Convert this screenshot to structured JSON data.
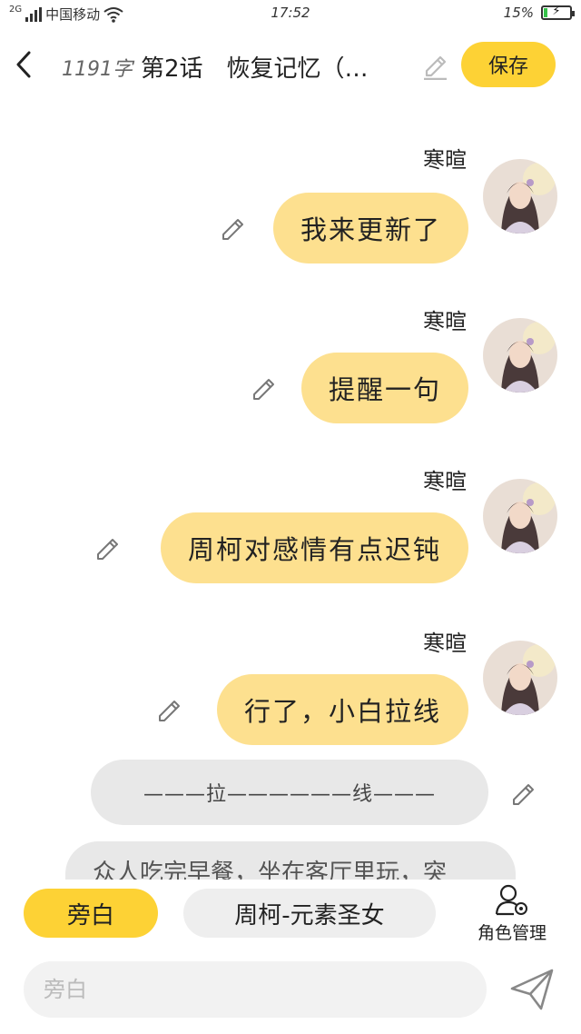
{
  "status_bar": {
    "network": "2G",
    "carrier": "中国移动",
    "time": "17:52",
    "battery_percent": "15%",
    "battery_level": 0.15,
    "icons": [
      "signal-icon",
      "wifi-icon",
      "battery-charging-icon"
    ]
  },
  "header": {
    "word_count": "1191字",
    "chapter_title": "第2话　恢复记忆（…",
    "save_label": "保存",
    "icons": [
      "back-icon",
      "edit-icon"
    ]
  },
  "messages": [
    {
      "speaker": "寒暄",
      "text": "我来更新了"
    },
    {
      "speaker": "寒暄",
      "text": "提醒一句"
    },
    {
      "speaker": "寒暄",
      "text": "周柯对感情有点迟钝"
    },
    {
      "speaker": "寒暄",
      "text": "行了，小白拉线"
    }
  ],
  "narration_divider": "———拉——————线———",
  "narration_partial": "众人吃完早餐，坐在客厅里玩，突",
  "bottom": {
    "role_narration": "旁白",
    "role_character": "周柯-元素圣女",
    "role_manage_label": "角色管理",
    "input_placeholder": "旁白",
    "icons": [
      "role-settings-icon",
      "send-icon"
    ]
  },
  "colors": {
    "accent_yellow": "#fdd235",
    "bubble_yellow": "#fde08f",
    "bubble_gray": "#e8e8e8",
    "battery_green": "#36c24a"
  }
}
